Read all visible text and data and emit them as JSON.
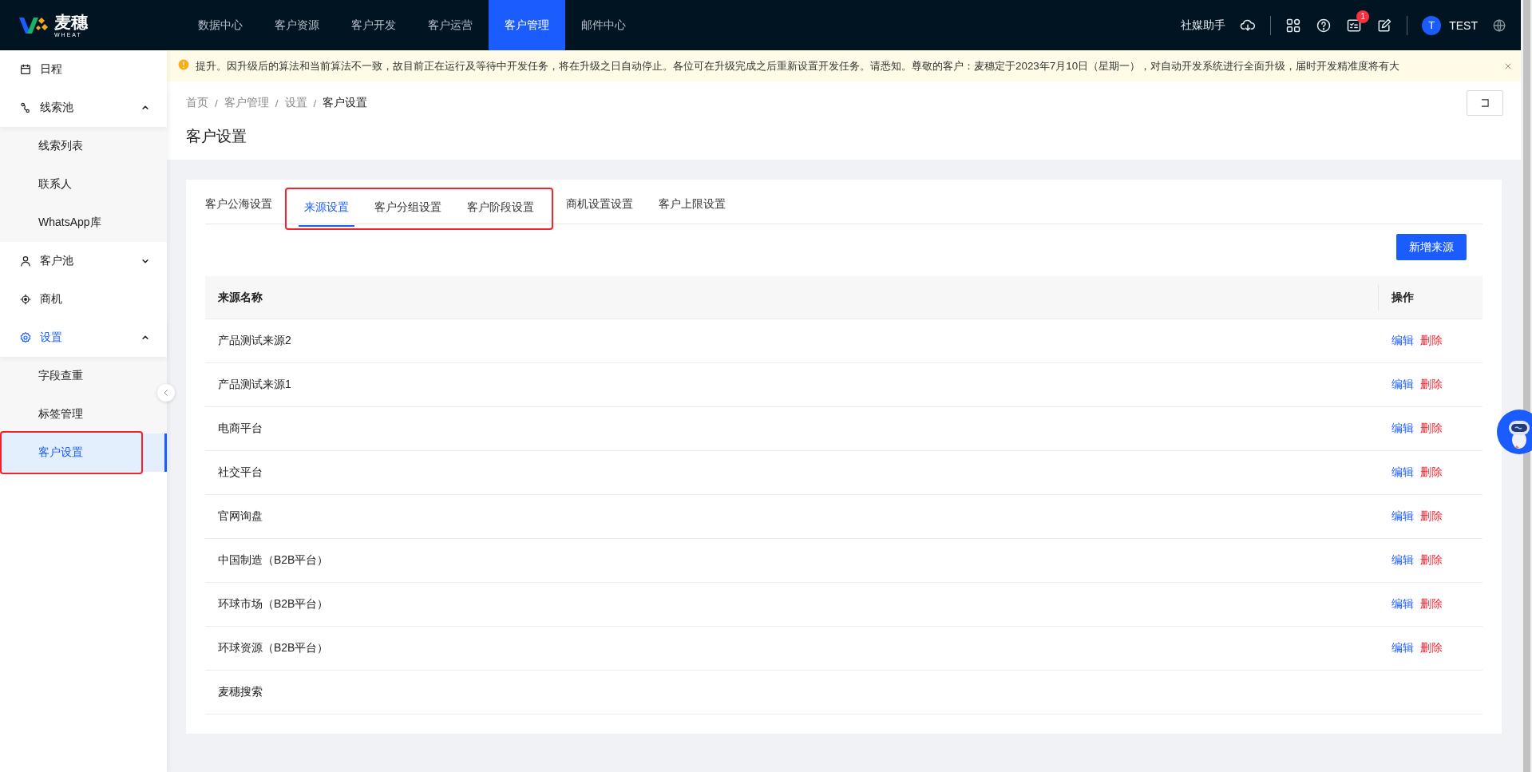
{
  "brand": {
    "name": "麦穗",
    "tagline": "WHEAT"
  },
  "nav": [
    {
      "label": "数据中心",
      "selected": false
    },
    {
      "label": "客户资源",
      "selected": false
    },
    {
      "label": "客户开发",
      "selected": false
    },
    {
      "label": "客户运营",
      "selected": false
    },
    {
      "label": "客户管理",
      "selected": true
    },
    {
      "label": "邮件中心",
      "selected": false
    }
  ],
  "header_tools": {
    "assistant": "社媒助手",
    "task_badge": "1",
    "user": {
      "initial": "T",
      "name": "TEST"
    }
  },
  "notice": {
    "text": "提升。因升级后的算法和当前算法不一致，故目前正在运行及等待中开发任务，将在升级之日自动停止。各位可在升级完成之后重新设置开发任务。请悉知。尊敬的客户：麦穗定于2023年7月10日（星期一），对自动开发系统进行全面升级，届时开发精准度将有大"
  },
  "sidebar": {
    "items": [
      {
        "label": "日程",
        "active": false
      },
      {
        "label": "线索池",
        "active": false,
        "expanded": true,
        "children": [
          {
            "label": "线索列表",
            "selected": false,
            "highlighted": false
          },
          {
            "label": "联系人",
            "selected": false,
            "highlighted": false
          },
          {
            "label": "WhatsApp库",
            "selected": false,
            "highlighted": false
          }
        ]
      },
      {
        "label": "客户池",
        "active": false,
        "expanded": false
      },
      {
        "label": "商机",
        "active": false
      },
      {
        "label": "设置",
        "active": true,
        "expanded": true,
        "children": [
          {
            "label": "字段查重",
            "selected": false,
            "highlighted": false
          },
          {
            "label": "标签管理",
            "selected": false,
            "highlighted": false
          },
          {
            "label": "客户设置",
            "selected": true,
            "highlighted": true
          }
        ]
      }
    ]
  },
  "breadcrumb": [
    {
      "text": "首页",
      "kind": "link"
    },
    {
      "text": "/",
      "kind": "separator"
    },
    {
      "text": "客户管理",
      "kind": "link"
    },
    {
      "text": "/",
      "kind": "separator"
    },
    {
      "text": "设置",
      "kind": "link"
    },
    {
      "text": "/",
      "kind": "separator"
    },
    {
      "text": "客户设置",
      "kind": "current"
    }
  ],
  "page_title": "客户设置",
  "tabs": [
    {
      "label": "客户公海设置",
      "selected": false,
      "highlighted": false
    },
    {
      "label": "来源设置",
      "selected": true,
      "highlighted": true
    },
    {
      "label": "客户分组设置",
      "selected": false,
      "highlighted": true
    },
    {
      "label": "客户阶段设置",
      "selected": false,
      "highlighted": true
    },
    {
      "label": "商机设置设置",
      "selected": false,
      "highlighted": false
    },
    {
      "label": "客户上限设置",
      "selected": false,
      "highlighted": false
    }
  ],
  "add_button": "新增来源",
  "table": {
    "columns": [
      "来源名称",
      "操作"
    ],
    "rows": [
      {
        "name": "产品测试来源2",
        "actions": [
          {
            "label": "编辑",
            "kind": "edit"
          },
          {
            "label": "删除",
            "kind": "delete"
          }
        ]
      },
      {
        "name": "产品测试来源1",
        "actions": [
          {
            "label": "编辑",
            "kind": "edit"
          },
          {
            "label": "删除",
            "kind": "delete"
          }
        ]
      },
      {
        "name": "电商平台",
        "actions": [
          {
            "label": "编辑",
            "kind": "edit"
          },
          {
            "label": "删除",
            "kind": "delete"
          }
        ]
      },
      {
        "name": "社交平台",
        "actions": [
          {
            "label": "编辑",
            "kind": "edit"
          },
          {
            "label": "删除",
            "kind": "delete"
          }
        ]
      },
      {
        "name": "官网询盘",
        "actions": [
          {
            "label": "编辑",
            "kind": "edit"
          },
          {
            "label": "删除",
            "kind": "delete"
          }
        ]
      },
      {
        "name": "中国制造（B2B平台）",
        "actions": [
          {
            "label": "编辑",
            "kind": "edit"
          },
          {
            "label": "删除",
            "kind": "delete"
          }
        ]
      },
      {
        "name": "环球市场（B2B平台）",
        "actions": [
          {
            "label": "编辑",
            "kind": "edit"
          },
          {
            "label": "删除",
            "kind": "delete"
          }
        ]
      },
      {
        "name": "环球资源（B2B平台）",
        "actions": [
          {
            "label": "编辑",
            "kind": "edit"
          },
          {
            "label": "删除",
            "kind": "delete"
          }
        ]
      },
      {
        "name": "麦穗搜索",
        "actions": []
      }
    ]
  }
}
